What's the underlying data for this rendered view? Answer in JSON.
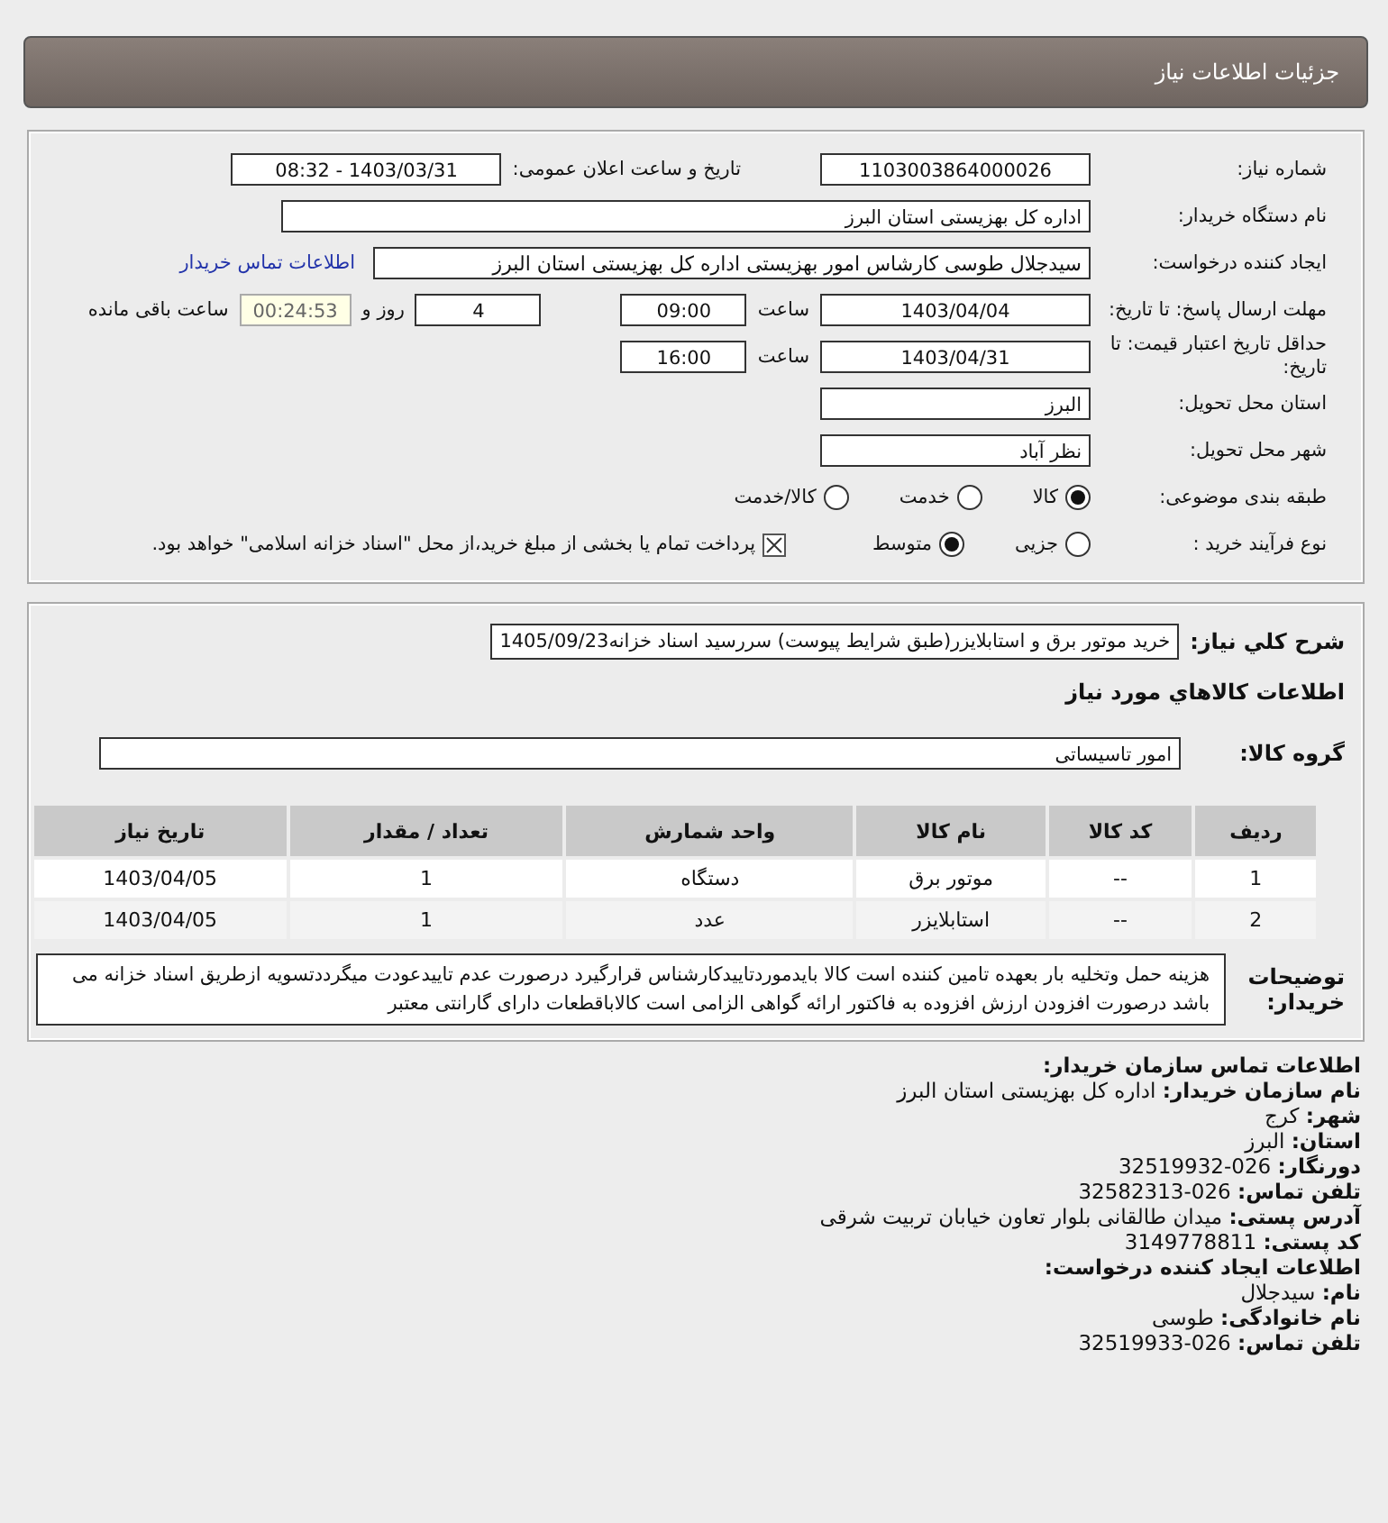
{
  "header": {
    "title": "جزئیات اطلاعات نیاز"
  },
  "need": {
    "number": {
      "label": "شماره نیاز:",
      "value": "1103003864000026"
    },
    "announce": {
      "label": "تاریخ و ساعت اعلان عمومی:",
      "value": "1403/03/31 - 08:32"
    },
    "buyer": {
      "label": "نام دستگاه خريدار:",
      "value": "اداره کل بهزیستی استان البرز"
    },
    "creator": {
      "label": "ایجاد کننده درخواست:",
      "value": "سیدجلال طوسی کارشاس امور بهزیستی اداره کل بهزیستی استان البرز",
      "link": "اطلاعات تماس خریدار"
    },
    "deadline": {
      "label": "مهلت ارسال پاسخ: تا تاریخ:",
      "date": "1403/04/04",
      "time_label": "ساعت",
      "time": "09:00",
      "days": "4",
      "days_label": "روز و",
      "remaining": "00:24:53",
      "remaining_label": "ساعت باقی مانده"
    },
    "validity": {
      "label": "حداقل تاریخ اعتبار قیمت: تا تاریخ:",
      "date": "1403/04/31",
      "time_label": "ساعت",
      "time": "16:00"
    },
    "province": {
      "label": "استان محل تحویل:",
      "value": "البرز"
    },
    "city": {
      "label": "شهر محل تحویل:",
      "value": "نظر آباد"
    },
    "category": {
      "label": "طبقه بندی موضوعی:",
      "options": [
        {
          "label": "کالا",
          "selected": true
        },
        {
          "label": "خدمت",
          "selected": false
        },
        {
          "label": "کالا/خدمت",
          "selected": false
        }
      ]
    },
    "process": {
      "label": "نوع فرآیند خرید :",
      "options": [
        {
          "label": "جزیی",
          "selected": false
        },
        {
          "label": "متوسط",
          "selected": true
        }
      ],
      "payment": {
        "label": "پرداخت تمام یا بخشی از مبلغ خرید،از محل \"اسناد خزانه اسلامی\" خواهد بود.",
        "checked": true
      }
    }
  },
  "goods": {
    "summary": {
      "label": "شرح کلي نياز:",
      "value": "خرید موتور برق و استابلایزر(طبق شرایط پیوست) سررسید اسناد خزانه1405/09/23"
    },
    "heading": "اطلاعات کالاهاي مورد نياز",
    "group": {
      "label": "گروه کالا:",
      "value": "امور تاسیساتی"
    },
    "table": {
      "columns": [
        "رديف",
        "کد کالا",
        "نام کالا",
        "واحد شمارش",
        "تعداد / مقدار",
        "تاريخ نياز"
      ],
      "rows": [
        [
          "1",
          "--",
          "موتور برق",
          "دستگاه",
          "1",
          "1403/04/05"
        ],
        [
          "2",
          "--",
          "استابلایزر",
          "عدد",
          "1",
          "1403/04/05"
        ]
      ]
    },
    "notes": {
      "label": "توضیحات خریدار:",
      "value": "هزینه حمل وتخلیه بار بعهده تامین کننده است کالا بایدموردتاییدکارشناس قرارگیرد درصورت عدم تاییدعودت میگرددتسویه ازطریق اسناد خزانه می باشد درصورت افزودن ارزش افزوده به فاکتور ارائه گواهی الزامی است کالاباقطعات دارای گارانتی معتبر"
    }
  },
  "contact": {
    "heading": "اطلاعات تماس سازمان خریدار:",
    "lines": [
      "**نام سازمان خریدار:** اداره کل بهزیستی استان البرز",
      "**شهر:** کرج",
      "**استان:** البرز",
      "**دورنگار:** 026-32519932",
      "**تلفن تماس:** 026-32582313",
      "**آدرس پستی:** میدان طالقانی بلوار تعاون خیابان تربیت شرقی",
      "**کد پستی:** 3149778811"
    ],
    "creator_heading": "اطلاعات ایجاد کننده درخواست:",
    "creator_lines": [
      "**نام:** سیدجلال",
      "**نام خانوادگی:** طوسی",
      "**تلفن تماس:** 026-32519933"
    ]
  }
}
